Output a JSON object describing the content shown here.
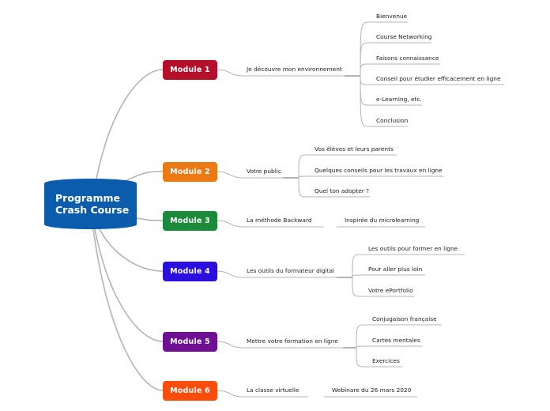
{
  "root": {
    "line1": "Programme",
    "line2": "Crash Course",
    "color": "#0b5cad"
  },
  "line_color": "#b4b4b4",
  "modules": [
    {
      "label": "Module 1",
      "color": "#b50f2c",
      "topic": "Je découvre mon environnement",
      "children": [
        "Bienvenue",
        "Course Networking",
        "Faisons connaissance",
        "Conseil pour étudier efficacement en ligne",
        "e-Learning, etc.",
        "Conclusion"
      ]
    },
    {
      "label": "Module 2",
      "color": "#ec7a14",
      "topic": "Votre public",
      "children": [
        "Vos élèves et leurs parents",
        "Quelques conseils pour les travaux en ligne",
        "Quel ton adopter ?"
      ]
    },
    {
      "label": "Module 3",
      "color": "#1b8a3a",
      "topic": "La méthode Backward",
      "children": [
        "Inspirée du microlearning"
      ]
    },
    {
      "label": "Module 4",
      "color": "#2a0fe0",
      "topic": "Les outils du formateur digital",
      "children": [
        "Les outils pour former en ligne",
        "Pour aller plus loin",
        "Votre ePortfolio"
      ]
    },
    {
      "label": "Module 5",
      "color": "#6f0f94",
      "topic": "Mettre votre formation en ligne",
      "children": [
        "Conjugaison française",
        "Cartes mentales",
        "Exercices"
      ]
    },
    {
      "label": "Module 6",
      "color": "#fc4c0c",
      "topic": "La classe virtuelle",
      "children": [
        "Webinare du 26 mars 2020"
      ]
    }
  ]
}
